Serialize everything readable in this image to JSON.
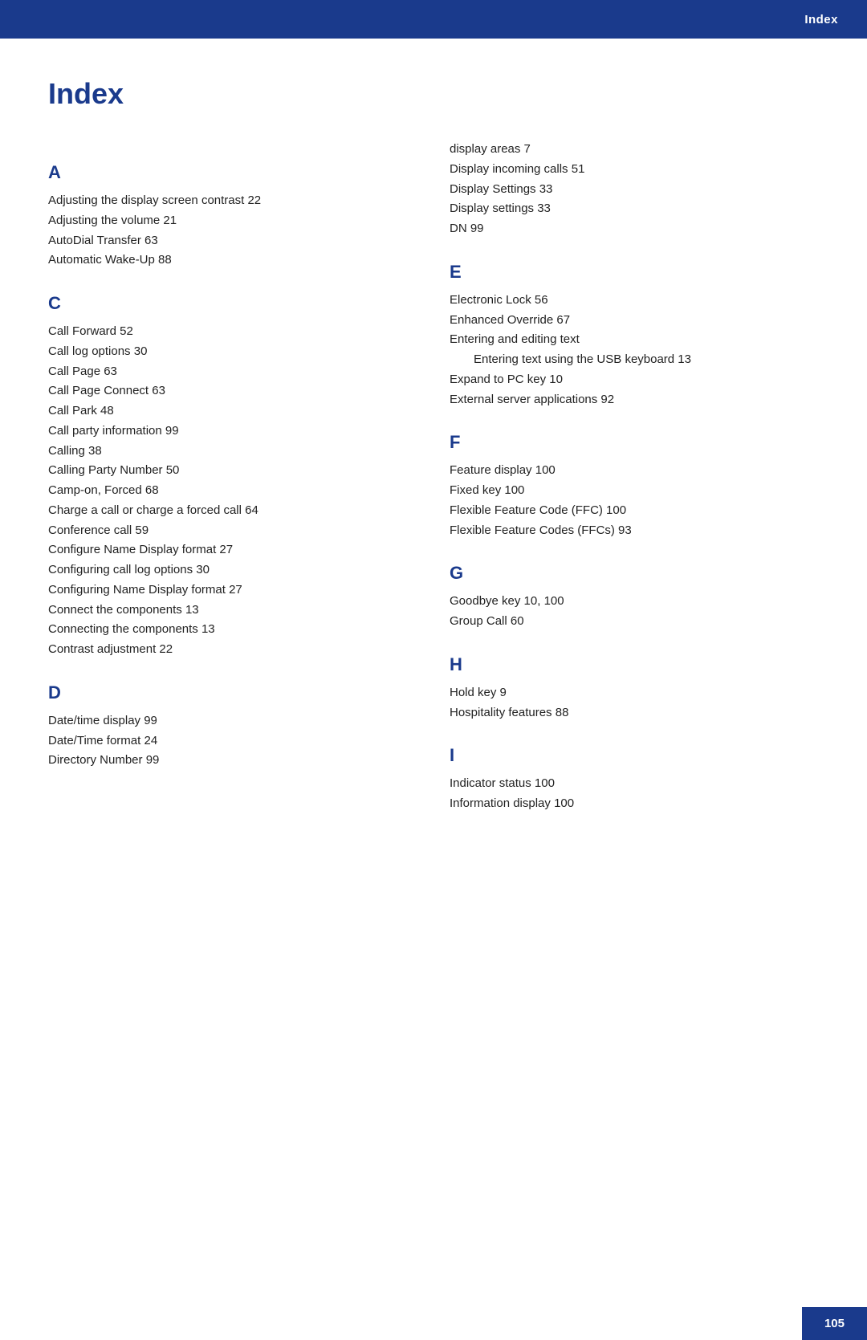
{
  "header": {
    "label": "Index"
  },
  "page_title": "Index",
  "left_column": [
    {
      "letter": "A",
      "entries": [
        "Adjusting the display screen contrast 22",
        "Adjusting the volume 21",
        "AutoDial Transfer 63",
        "Automatic Wake-Up 88"
      ]
    },
    {
      "letter": "C",
      "entries": [
        "Call Forward 52",
        "Call log options 30",
        "Call Page 63",
        "Call Page Connect 63",
        "Call Park 48",
        "Call party information 99",
        "Calling 38",
        "Calling Party Number 50",
        "Camp-on, Forced 68",
        "Charge a call or charge a forced call 64",
        "Conference call 59",
        "Configure Name Display format 27",
        "Configuring call log options 30",
        "Configuring Name Display format 27",
        "Connect the components 13",
        "Connecting the components 13",
        "Contrast adjustment 22"
      ]
    },
    {
      "letter": "D",
      "entries": [
        "Date/time display 99",
        "Date/Time format 24",
        "Directory Number 99"
      ]
    }
  ],
  "right_column": [
    {
      "letter": "",
      "entries": [
        "display areas 7",
        "Display incoming calls 51",
        "Display Settings 33",
        "Display settings 33",
        "DN 99"
      ]
    },
    {
      "letter": "E",
      "entries": [
        "Electronic Lock 56",
        "Enhanced Override 67",
        "Entering and editing text",
        "sub:Entering text using the USB keyboard 13",
        "Expand to PC key 10",
        "External server applications 92"
      ]
    },
    {
      "letter": "F",
      "entries": [
        "Feature display 100",
        "Fixed key 100",
        "Flexible Feature Code (FFC) 100",
        "Flexible Feature Codes (FFCs) 93"
      ]
    },
    {
      "letter": "G",
      "entries": [
        "Goodbye key 10, 100",
        "Group Call 60"
      ]
    },
    {
      "letter": "H",
      "entries": [
        "Hold key 9",
        "Hospitality features 88"
      ]
    },
    {
      "letter": "I",
      "entries": [
        "Indicator status 100",
        "Information display 100"
      ]
    }
  ],
  "footer": {
    "page_number": "105"
  }
}
